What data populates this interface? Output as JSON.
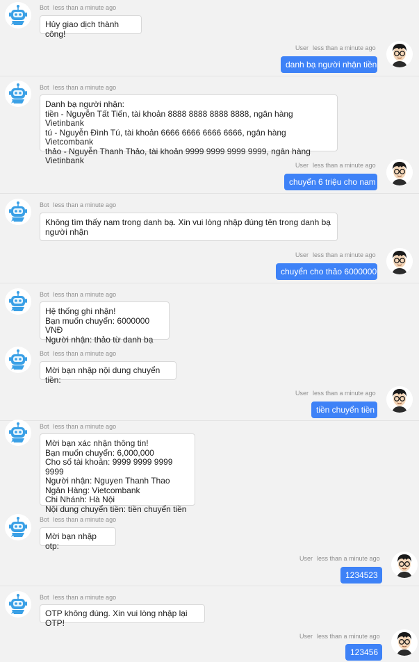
{
  "chat": {
    "messages": [
      {
        "sender": "Bot",
        "time": "less than a minute ago",
        "text": "Hủy giao dịch thành công!"
      },
      {
        "sender": "User",
        "time": "less than a minute ago",
        "text": "danh bạ người nhận tiền"
      },
      {
        "sender": "Bot",
        "time": "less than a minute ago",
        "text": "Danh bạ người nhận:\ntiền - Nguyễn Tất Tiến, tài khoản 8888 8888 8888 8888, ngân hàng Vietinbank\ntú - Nguyễn Đình Tú, tài khoản 6666 6666 6666 6666, ngân hàng Vietcombank\nthảo - Nguyễn Thanh Thảo, tài khoản 9999 9999 9999 9999, ngân hàng Vietinbank"
      },
      {
        "sender": "User",
        "time": "less than a minute ago",
        "text": "chuyển 6 triệu cho nam"
      },
      {
        "sender": "Bot",
        "time": "less than a minute ago",
        "text": "Không tìm thấy nam trong danh bạ. Xin vui lòng nhập đúng tên trong danh bạ người nhận"
      },
      {
        "sender": "User",
        "time": "less than a minute ago",
        "text": "chuyển cho thảo 6000000"
      },
      {
        "sender": "Bot",
        "time": "less than a minute ago",
        "text": "Hệ thống ghi nhận!\nBạn muốn chuyển: 6000000 VNĐ\nNgười nhận: thảo từ danh bạ"
      },
      {
        "sender": "Bot",
        "time": "less than a minute ago",
        "text": "Mời bạn nhập nội dung chuyển tiền:"
      },
      {
        "sender": "User",
        "time": "less than a minute ago",
        "text": "tiền chuyển tiền"
      },
      {
        "sender": "Bot",
        "time": "less than a minute ago",
        "text": "Mời bạn xác nhận thông tin!\nBạn muốn chuyển: 6,000,000\nCho số tài khoản: 9999 9999 9999 9999\nNgười nhận: Nguyen Thanh Thao\nNgân Hàng: Vietcombank\nChi Nhánh: Hà Nội\nNội dung chuyển tiền: tiền chuyển tiền"
      },
      {
        "sender": "Bot",
        "time": "less than a minute ago",
        "text": "Mời bạn nhập otp:"
      },
      {
        "sender": "User",
        "time": "less than a minute ago",
        "text": "1234523"
      },
      {
        "sender": "Bot",
        "time": "less than a minute ago",
        "text": "OTP không đúng. Xin vui lòng nhập lại OTP!"
      },
      {
        "sender": "User",
        "time": "less than a minute ago",
        "text": "123456"
      }
    ]
  },
  "icons": {
    "bot": "robot-icon",
    "user": "user-glasses-icon"
  },
  "colors": {
    "user_bubble": "#3e82f7",
    "bot_accent": "#3aa0e6",
    "background": "#f2f2f2"
  }
}
